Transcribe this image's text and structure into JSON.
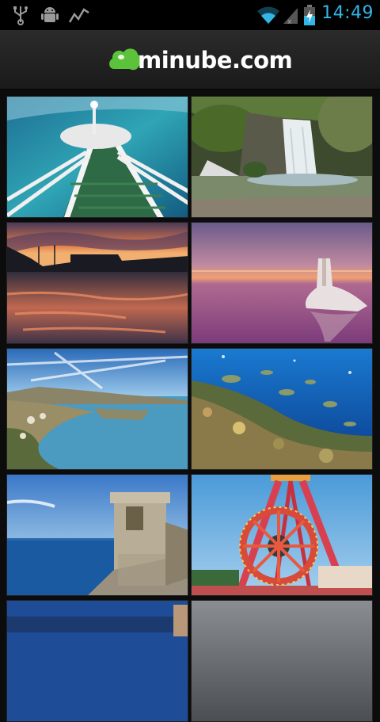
{
  "status_bar": {
    "time": "14:49",
    "left_icons": [
      "usb-icon",
      "android-debug-icon",
      "activity-icon"
    ],
    "right_icons": [
      "wifi-icon",
      "signal-icon",
      "battery-charging-icon"
    ],
    "accent_color": "#33b5e5"
  },
  "app": {
    "logo_text": "minube.com",
    "logo_color": "#5cc13b"
  },
  "photos": [
    {
      "scene": "pier-staircase"
    },
    {
      "scene": "waterfall"
    },
    {
      "scene": "harbor-sunset"
    },
    {
      "scene": "pink-lagoon-rock"
    },
    {
      "scene": "coastal-bay"
    },
    {
      "scene": "underwater-reef"
    },
    {
      "scene": "watchtower-sea"
    },
    {
      "scene": "fairground-ride"
    },
    {
      "scene": "partial-sky"
    },
    {
      "scene": "partial-sky"
    }
  ]
}
